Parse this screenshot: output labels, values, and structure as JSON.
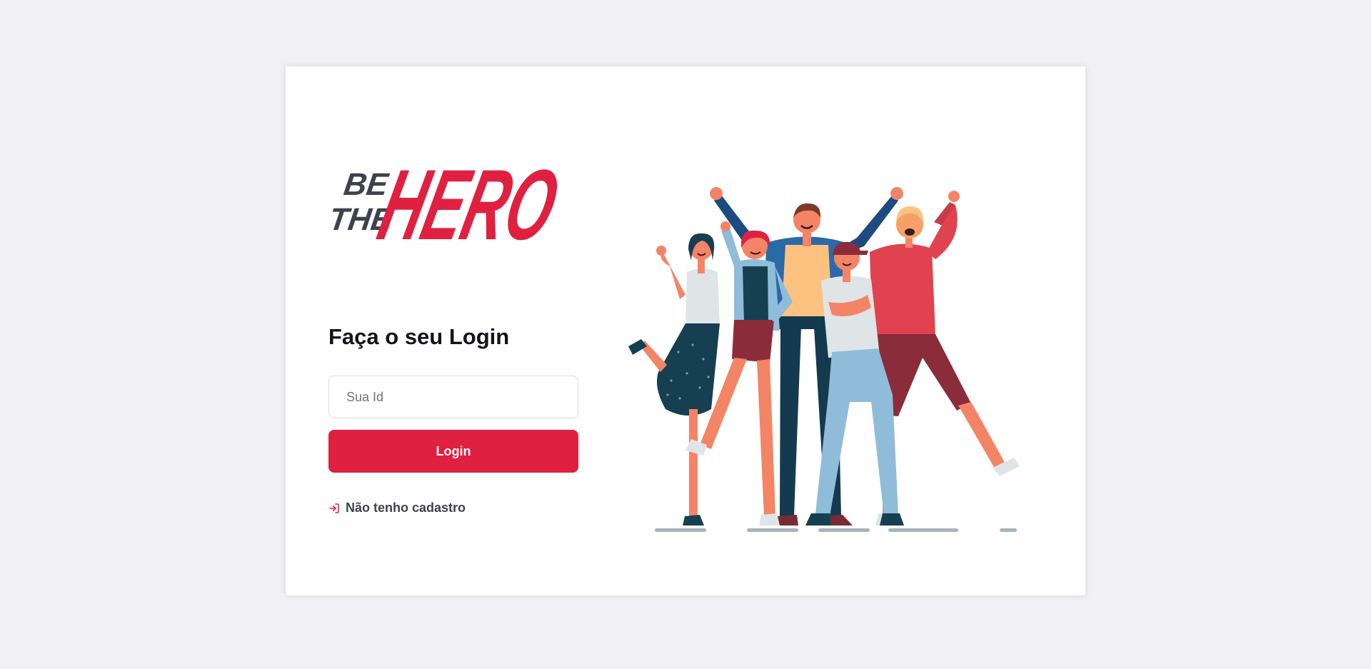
{
  "logo": {
    "text_be": "BE",
    "text_the": "THE",
    "text_hero": "HERO",
    "color_primary": "#e02041",
    "color_dark": "#41414d"
  },
  "form": {
    "title": "Faça o seu Login",
    "id_placeholder": "Sua Id",
    "id_value": "",
    "login_label": "Login"
  },
  "register": {
    "label": "Não tenho cadastro",
    "icon": "log-in-icon"
  },
  "illustration": {
    "name": "heroes-illustration"
  },
  "colors": {
    "background": "#f0f0f5",
    "card": "#ffffff",
    "accent": "#e02041",
    "text": "#13131a"
  }
}
